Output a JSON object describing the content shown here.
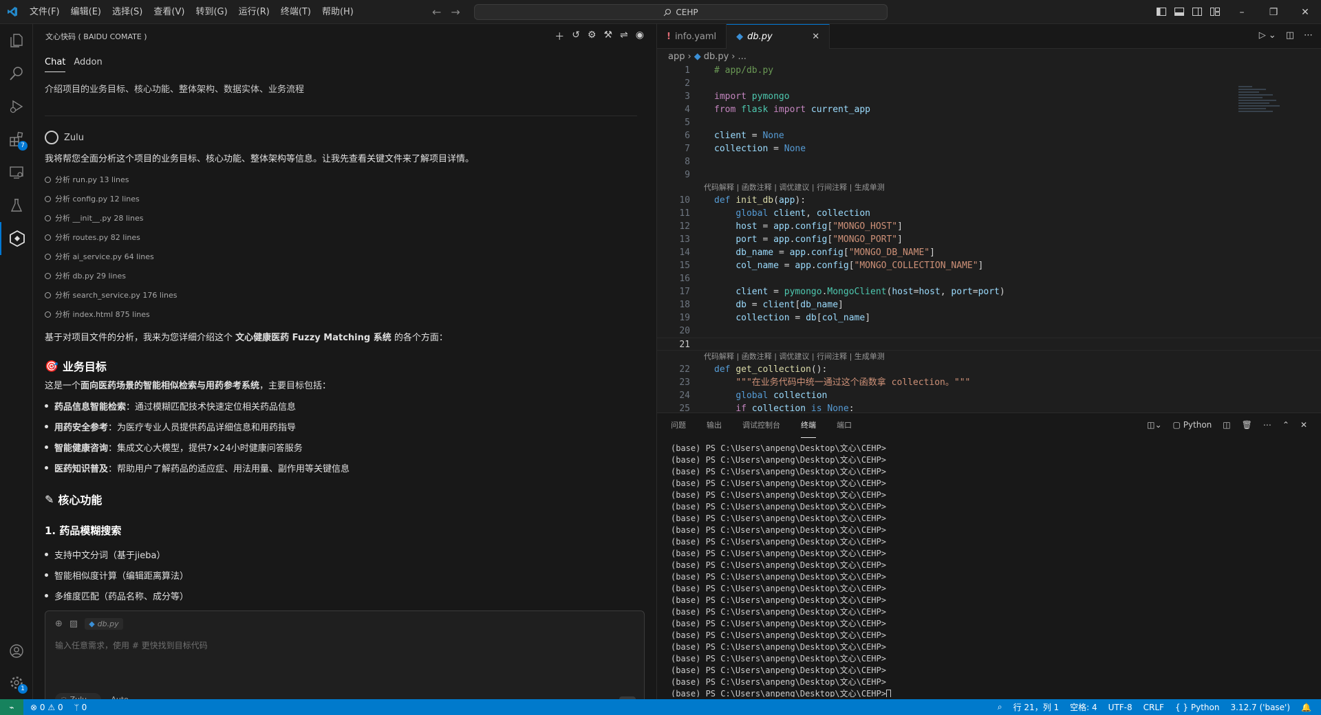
{
  "titlebar": {
    "menus": [
      "文件(F)",
      "编辑(E)",
      "选择(S)",
      "查看(V)",
      "转到(G)",
      "运行(R)",
      "终端(T)",
      "帮助(H)"
    ],
    "search": "CEHP"
  },
  "activity_badges": {
    "extensions": "7",
    "settings": "1"
  },
  "chat": {
    "header_title": "文心快码 ( BAIDU COMATE )",
    "tabs": [
      "Chat",
      "Addon"
    ],
    "user_question": "介绍项目的业务目标、核心功能、整体架构、数据实体、业务流程",
    "agent_name": "Zulu",
    "intro": "我将帮您全面分析这个项目的业务目标、核心功能、整体架构等信息。让我先查看关键文件来了解项目详情。",
    "tools": [
      "分析 run.py 13 lines",
      "分析 config.py 12 lines",
      "分析 __init__.py 28 lines",
      "分析 routes.py 82 lines",
      "分析 ai_service.py 64 lines",
      "分析 db.py 29 lines",
      "分析 search_service.py 176 lines",
      "分析 index.html 875 lines"
    ],
    "summary_pre": "基于对项目文件的分析，我来为您详细介绍这个 ",
    "summary_bold": "文心健康医药 Fuzzy Matching 系统",
    "summary_post": " 的各个方面：",
    "section1_title": "业务目标",
    "section1_pre": "这是一个",
    "section1_bold": "面向医药场景的智能相似检索与用药参考系统",
    "section1_post": "，主要目标包括：",
    "goals": [
      {
        "bold": "药品信息智能检索",
        "text": "：通过模糊匹配技术快速定位相关药品信息"
      },
      {
        "bold": "用药安全参考",
        "text": "：为医疗专业人员提供药品详细信息和用药指导"
      },
      {
        "bold": "智能健康咨询",
        "text": "：集成文心大模型，提供7×24小时健康问答服务"
      },
      {
        "bold": "医药知识普及",
        "text": "：帮助用户了解药品的适应症、用法用量、副作用等关键信息"
      }
    ],
    "section2_title": "核心功能",
    "sub1_title": "1. 药品模糊搜索",
    "features": [
      "支持中文分词（基于jieba）",
      "智能相似度计算（编辑距离算法）",
      "多维度匹配（药品名称、成分等）"
    ],
    "input_chip": "db.py",
    "input_placeholder": "输入任意需求，使用 # 更快找到目标代码",
    "agent_pill": "Zulu",
    "mode_pill": "Auto"
  },
  "editor": {
    "tabs": [
      {
        "label": "info.yaml",
        "icon": "!"
      },
      {
        "label": "db.py",
        "icon": "py"
      }
    ],
    "breadcrumb": [
      "app",
      "db.py",
      "..."
    ],
    "codelens": "代码解释 | 函数注释 | 调优建议 | 行间注释 | 生成单测",
    "cursor_line": 21
  },
  "panel": {
    "tabs": [
      "问题",
      "输出",
      "调试控制台",
      "终端",
      "端口"
    ],
    "active_tab": "终端",
    "shell_label": "Python",
    "prompt": "(base) PS C:\\Users\\anpeng\\Desktop\\文心\\CEHP>",
    "line_count": 22
  },
  "statusbar": {
    "errors": "0",
    "warnings": "0",
    "ports": "0",
    "position": "行 21，列 1",
    "spaces": "空格: 4",
    "encoding": "UTF-8",
    "eol": "CRLF",
    "language": "Python",
    "interpreter": "3.12.7 ('base')"
  },
  "colors": {
    "accent": "#0078d4",
    "statusbar": "#007acc",
    "remote": "#16825d"
  }
}
